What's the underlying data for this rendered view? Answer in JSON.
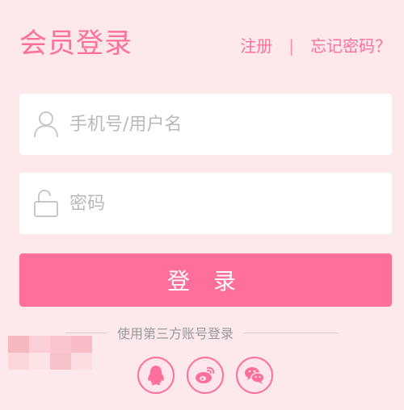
{
  "header": {
    "title": "会员登录",
    "register_link": "注册",
    "separator": "|",
    "forgot_link": "忘记密码？"
  },
  "form": {
    "username_placeholder": "手机号/用户名",
    "password_placeholder": "密码",
    "submit_label": "登 录"
  },
  "third_party": {
    "label": "使用第三方账号登录",
    "providers": [
      {
        "name": "qq",
        "icon": "qq-icon"
      },
      {
        "name": "weibo",
        "icon": "weibo-icon"
      },
      {
        "name": "wechat",
        "icon": "wechat-icon"
      }
    ]
  },
  "colors": {
    "accent": "#ff6f9b",
    "background": "#fde9ec",
    "field_bg": "#ffffff",
    "placeholder": "#b9b9b9"
  }
}
